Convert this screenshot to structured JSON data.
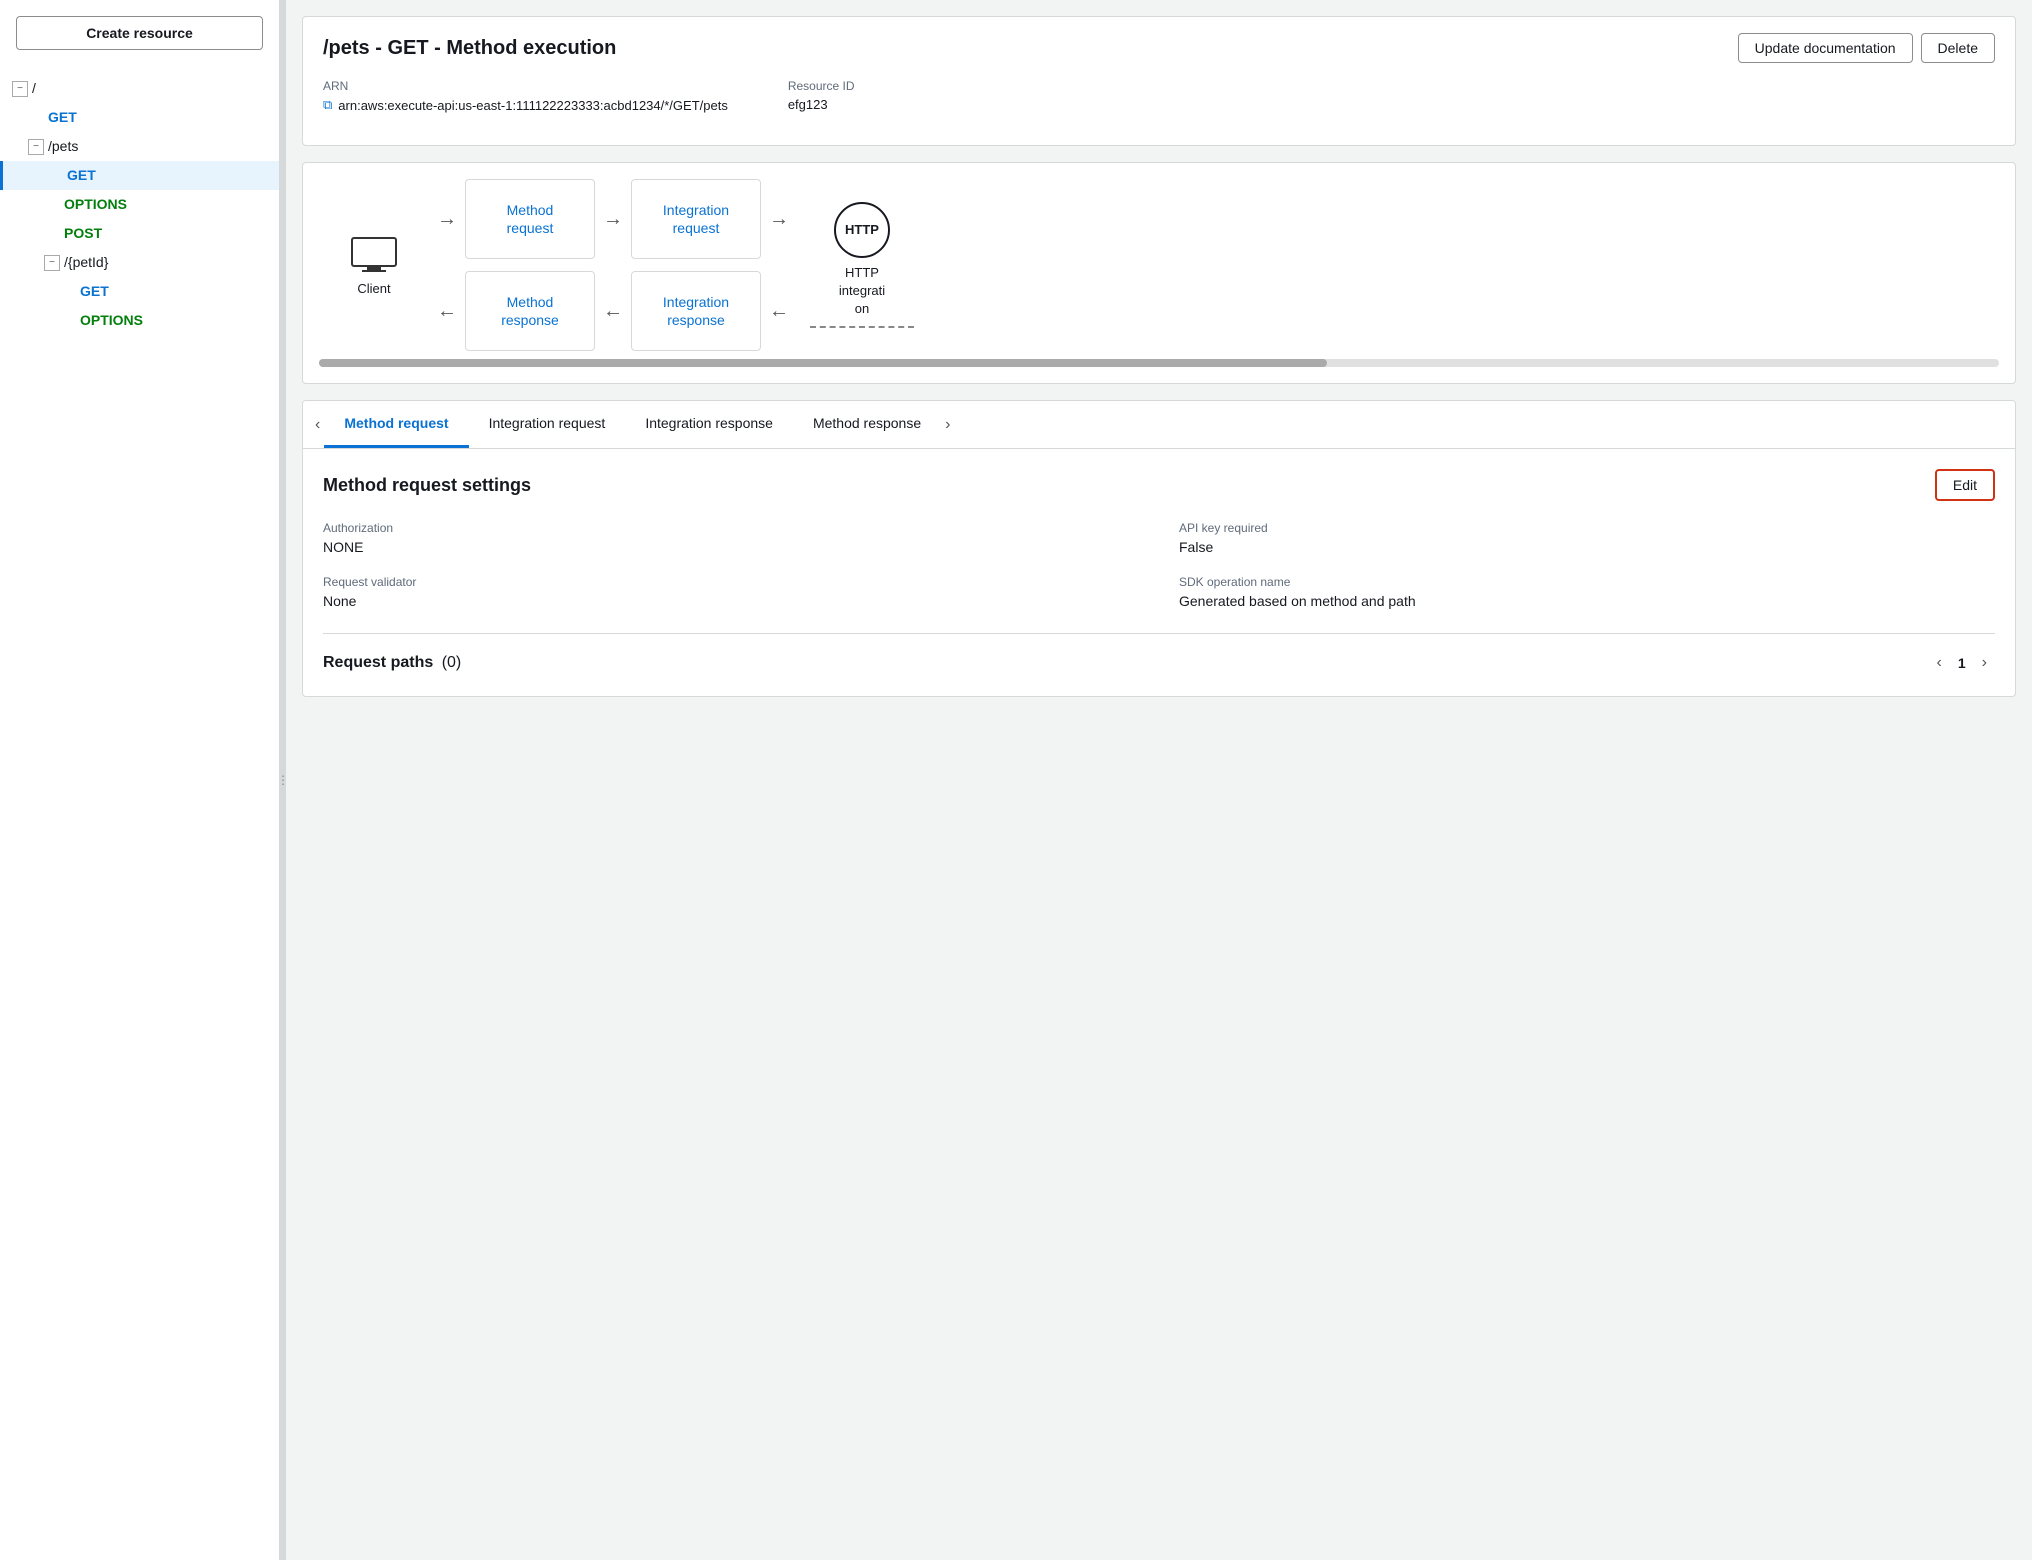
{
  "sidebar": {
    "create_resource_label": "Create resource",
    "items": [
      {
        "id": "root",
        "label": "/",
        "type": "resource",
        "indent": 1,
        "toggle": "−"
      },
      {
        "id": "root-get",
        "label": "GET",
        "type": "method-get",
        "indent": 2
      },
      {
        "id": "pets",
        "label": "/pets",
        "type": "resource",
        "indent": 2,
        "toggle": "−"
      },
      {
        "id": "pets-get",
        "label": "GET",
        "type": "method-get",
        "indent": 3,
        "active": true
      },
      {
        "id": "pets-options",
        "label": "OPTIONS",
        "type": "method-options",
        "indent": 3
      },
      {
        "id": "pets-post",
        "label": "POST",
        "type": "method-post",
        "indent": 3
      },
      {
        "id": "petId",
        "label": "/{petId}",
        "type": "resource",
        "indent": 3,
        "toggle": "−"
      },
      {
        "id": "petId-get",
        "label": "GET",
        "type": "method-get",
        "indent": 4
      },
      {
        "id": "petId-options",
        "label": "OPTIONS",
        "type": "method-options",
        "indent": 4
      }
    ]
  },
  "header": {
    "title": "/pets - GET - Method execution",
    "update_doc_label": "Update documentation",
    "delete_label": "Delete"
  },
  "meta": {
    "arn_label": "ARN",
    "arn_value": "arn:aws:execute-api:us-east-1:111122223333:acbd1234/*/GET/pets",
    "resource_id_label": "Resource ID",
    "resource_id_value": "efg123"
  },
  "diagram": {
    "client_label": "Client",
    "method_request_label": "Method\nrequest",
    "integration_request_label": "Integration\nrequest",
    "method_response_label": "Method\nresponse",
    "integration_response_label": "Integration\nresponse",
    "http_label": "HTTP\nintegrati\non",
    "http_circle_text": "HTTP"
  },
  "tabs": {
    "prev_label": "‹",
    "next_label": "›",
    "items": [
      {
        "id": "method-request",
        "label": "Method request",
        "active": true
      },
      {
        "id": "integration-request",
        "label": "Integration request"
      },
      {
        "id": "integration-response",
        "label": "Integration response"
      },
      {
        "id": "method-response",
        "label": "Method response"
      }
    ]
  },
  "settings": {
    "title": "Method request settings",
    "edit_label": "Edit",
    "authorization_label": "Authorization",
    "authorization_value": "NONE",
    "api_key_label": "API key required",
    "api_key_value": "False",
    "validator_label": "Request validator",
    "validator_value": "None",
    "sdk_label": "SDK operation name",
    "sdk_value": "Generated based on method and path",
    "paths_label": "Request paths",
    "paths_count": "(0)",
    "page_num": "1"
  }
}
